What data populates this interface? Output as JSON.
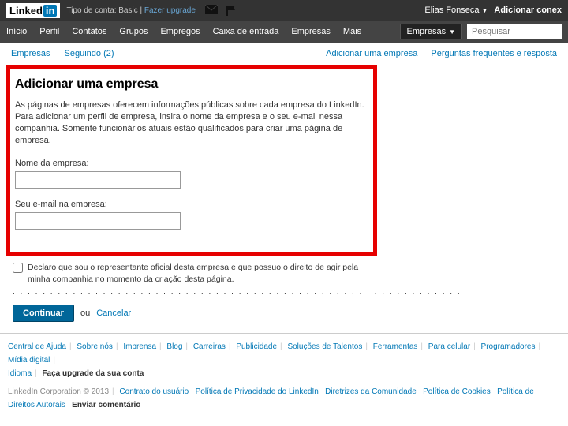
{
  "topbar": {
    "logo_text": "Linked",
    "logo_in": "in",
    "account_type_label": "Tipo de conta: Basic",
    "upgrade_link": "Fazer upgrade",
    "user_name": "Elias Fonseca",
    "add_connection": "Adicionar conex"
  },
  "nav": {
    "items": [
      "Início",
      "Perfil",
      "Contatos",
      "Grupos",
      "Empregos",
      "Caixa de entrada",
      "Empresas",
      "Mais"
    ],
    "dropdown_label": "Empresas",
    "search_placeholder": "Pesquisar"
  },
  "subnav": {
    "left": [
      "Empresas",
      "Seguindo (2)"
    ],
    "right": [
      "Adicionar uma empresa",
      "Perguntas frequentes e resposta"
    ]
  },
  "form": {
    "title": "Adicionar uma empresa",
    "description": "As páginas de empresas oferecem informações públicas sobre cada empresa do LinkedIn. Para adicionar um perfil de empresa, insira o nome da empresa e o seu e-mail nessa companhia. Somente funcionários atuais estão qualificados para criar uma página de empresa.",
    "company_name_label": "Nome da empresa:",
    "company_email_label": "Seu e-mail na empresa:",
    "checkbox_label": "Declaro que sou o representante oficial desta empresa e que possuo o direito de agir pela minha companhia no momento da criação desta página.",
    "continue_button": "Continuar",
    "or_text": "ou",
    "cancel_link": "Cancelar"
  },
  "footer": {
    "row1": [
      "Central de Ajuda",
      "Sobre nós",
      "Imprensa",
      "Blog",
      "Carreiras",
      "Publicidade",
      "Soluções de Talentos",
      "Ferramentas",
      "Para celular",
      "Programadores",
      "Mídia digital"
    ],
    "row1_extra_label": "Idioma",
    "row1_upgrade": "Faça upgrade da sua conta",
    "copyright": "LinkedIn Corporation © 2013",
    "row2": [
      "Contrato do usuário",
      "Política de Privacidade do LinkedIn",
      "Diretrizes da Comunidade",
      "Política de Cookies",
      "Política de Direitos Autorais",
      "Enviar comentário"
    ]
  }
}
